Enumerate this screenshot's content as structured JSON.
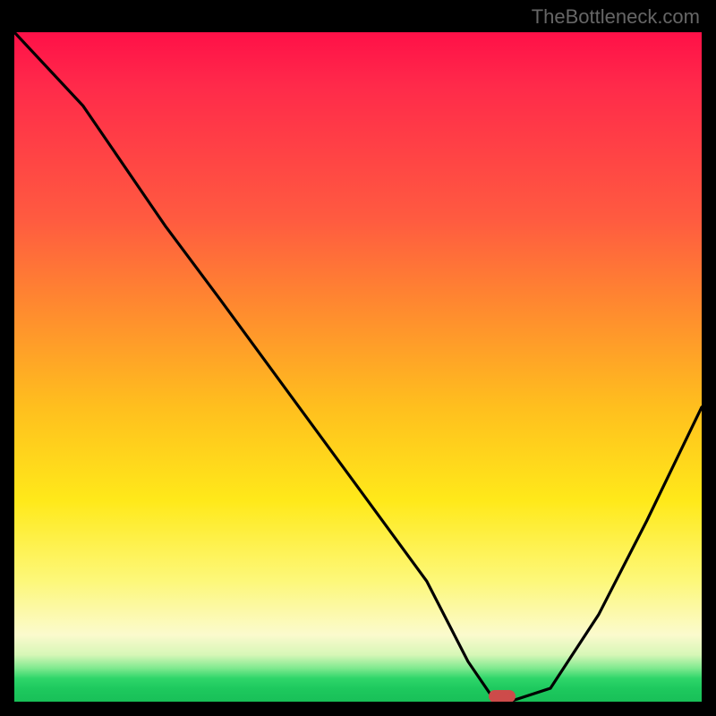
{
  "watermark": "TheBottleneck.com",
  "chart_data": {
    "type": "line",
    "title": "",
    "xlabel": "",
    "ylabel": "",
    "xlim": [
      0,
      100
    ],
    "ylim": [
      0,
      100
    ],
    "x": [
      0,
      10,
      20,
      22,
      30,
      40,
      50,
      60,
      66,
      70,
      72,
      78,
      85,
      92,
      100
    ],
    "values": [
      100,
      89,
      74,
      71,
      60,
      46,
      32,
      18,
      6,
      0,
      0,
      2,
      13,
      27,
      44
    ],
    "background_gradient_stops": [
      {
        "pos": 0,
        "color": "#ff1048"
      },
      {
        "pos": 28,
        "color": "#ff5b40"
      },
      {
        "pos": 56,
        "color": "#ffbf1e"
      },
      {
        "pos": 82,
        "color": "#fdf87a"
      },
      {
        "pos": 96,
        "color": "#2fd66a"
      },
      {
        "pos": 100,
        "color": "#18c058"
      }
    ],
    "optimum_marker": {
      "x": 71,
      "y": 0,
      "color": "#cd4b4a"
    }
  }
}
